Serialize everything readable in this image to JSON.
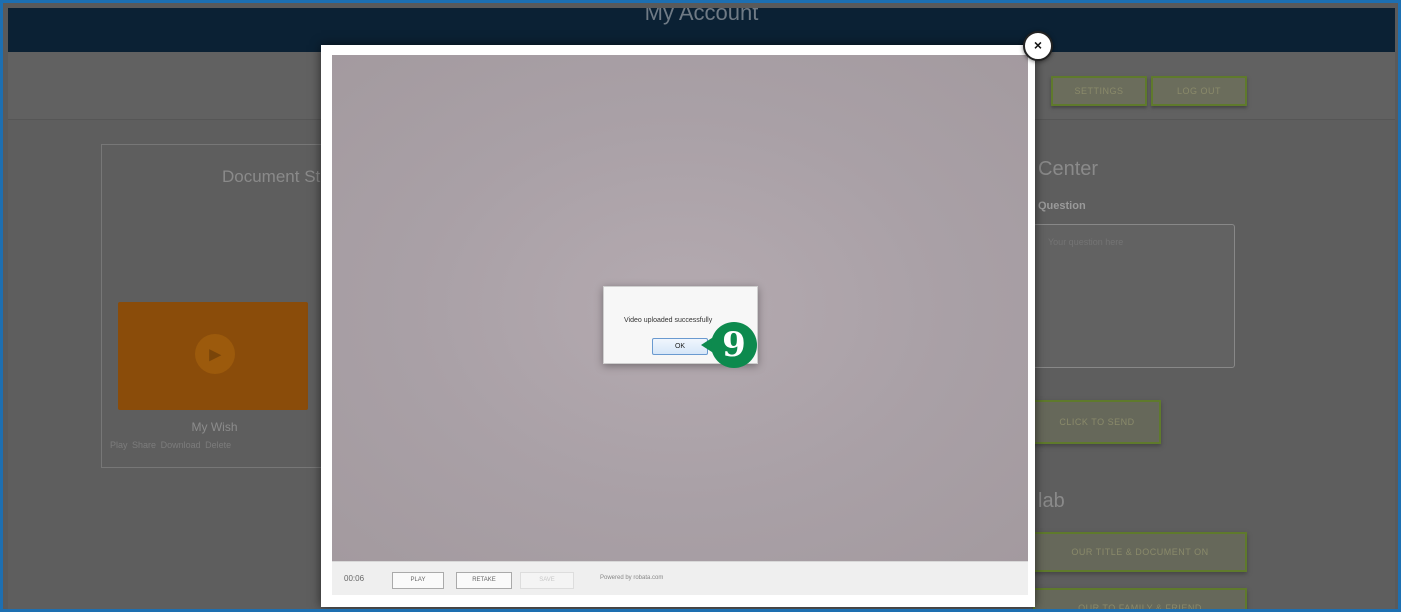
{
  "page": {
    "title": "My Account",
    "buttons": {
      "settings": "SETTINGS",
      "logout": "LOG OUT"
    }
  },
  "documents": {
    "heading": "Document Status",
    "item": {
      "name": "My Wish",
      "links": [
        "Play",
        "Share",
        "Download",
        "Delete"
      ]
    }
  },
  "help": {
    "heading": "Center",
    "question_label": "Question",
    "question_placeholder": "Your question here",
    "submit_label": "CLICK TO SEND",
    "heading_2": "lab",
    "buttons": [
      "OUR TITLE & DOCUMENT ON",
      "OUR TO FAMILY & FRIEND"
    ]
  },
  "modal": {
    "close_label": "×",
    "timer": "00:06",
    "controls": {
      "play": "PLAY",
      "retake": "RETAKE",
      "save": "SAVE"
    },
    "powered_by": "Powered by robata.com"
  },
  "alert": {
    "message": "Video uploaded successfully",
    "ok_label": "OK"
  },
  "step": {
    "number": "9",
    "color": "#0d8a4e"
  }
}
